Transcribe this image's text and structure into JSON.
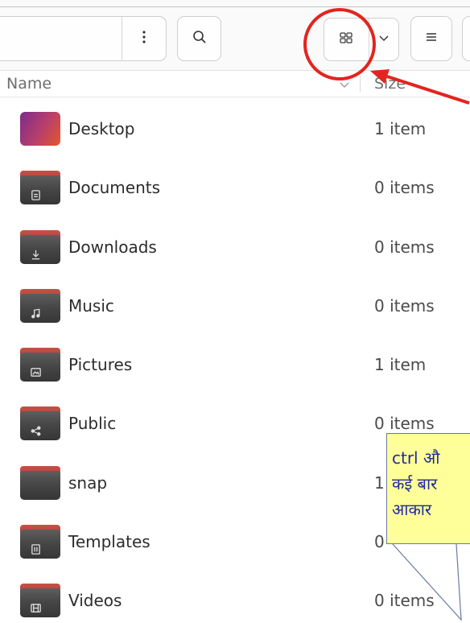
{
  "colors": {
    "annotation_red": "#e3241f",
    "callout_background": "#ffff99",
    "callout_text": "#1d2a9e",
    "callout_border": "#6b78a3",
    "folder_body": "#474747",
    "folder_tab": "#a23a42",
    "desktop_gradient_start": "#7f2b8c",
    "desktop_gradient_end": "#e5562a"
  },
  "toolbar": {
    "pathbar_menu_icon": "options-icon",
    "search_icon": "search-icon",
    "grid_view_icon": "grid-view-icon",
    "view_options_icon": "chevron-down-icon",
    "main_menu_icon": "hamburger-menu-icon"
  },
  "columns": {
    "name": "Name",
    "size": "Size",
    "sort_icon": "chevron-down-icon"
  },
  "files": [
    {
      "name": "Desktop",
      "size": "1 item",
      "icon": "desktop-folder-icon"
    },
    {
      "name": "Documents",
      "size": "0 items",
      "icon": "documents-folder-icon"
    },
    {
      "name": "Downloads",
      "size": "0 items",
      "icon": "downloads-folder-icon"
    },
    {
      "name": "Music",
      "size": "0 items",
      "icon": "music-folder-icon"
    },
    {
      "name": "Pictures",
      "size": "1 item",
      "icon": "pictures-folder-icon"
    },
    {
      "name": "Public",
      "size": "0 items",
      "icon": "public-folder-icon"
    },
    {
      "name": "snap",
      "size": "1",
      "icon": "folder-icon"
    },
    {
      "name": "Templates",
      "size": "0",
      "icon": "templates-folder-icon"
    },
    {
      "name": "Videos",
      "size": "0 items",
      "icon": "videos-folder-icon"
    }
  ],
  "annotation": {
    "callout_lines": [
      "ctrl औ",
      "कई बार",
      "आकार"
    ]
  }
}
